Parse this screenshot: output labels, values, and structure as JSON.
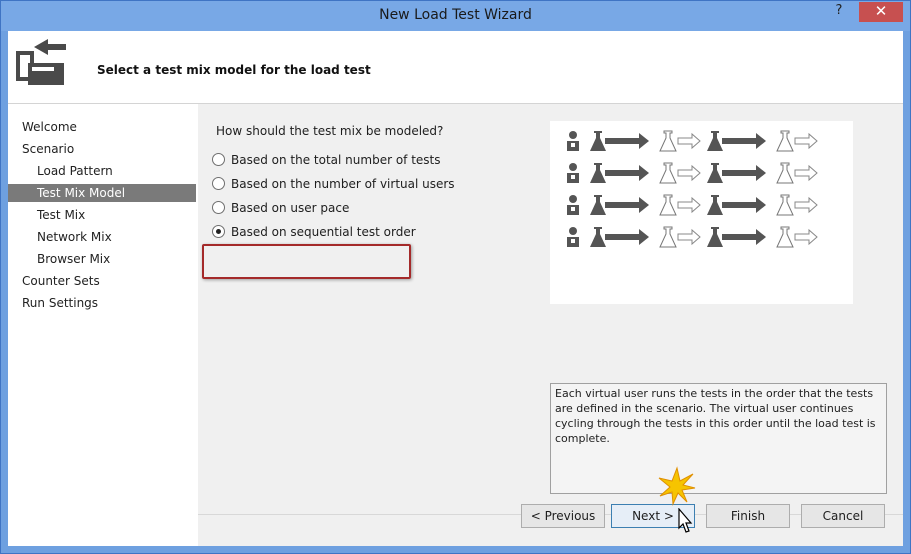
{
  "window": {
    "title": "New Load Test Wizard",
    "help": "?",
    "close": "✕"
  },
  "header": {
    "text": "Select a test mix model for the load test",
    "icon": "wizard-arrow-icon"
  },
  "sidebar": {
    "items": [
      {
        "label": "Welcome"
      },
      {
        "label": "Scenario"
      },
      {
        "label": "Load Pattern"
      },
      {
        "label": "Test Mix Model",
        "selected": true
      },
      {
        "label": "Test Mix"
      },
      {
        "label": "Network Mix"
      },
      {
        "label": "Browser Mix"
      },
      {
        "label": "Counter Sets"
      },
      {
        "label": "Run Settings"
      }
    ]
  },
  "main": {
    "question": "How should the test mix be modeled?",
    "options": [
      {
        "label": "Based on the total number of tests",
        "checked": false
      },
      {
        "label": "Based on the number of virtual users",
        "checked": false
      },
      {
        "label": "Based on user pace",
        "checked": false
      },
      {
        "label": "Based on sequential test order",
        "checked": true
      }
    ],
    "description": "Each virtual user runs the tests in the order that the tests are defined in the scenario. The virtual user continues cycling through the tests in this order until the load test is complete."
  },
  "buttons": {
    "previous": "< Previous",
    "next": "Next >",
    "finish": "Finish",
    "cancel": "Cancel"
  },
  "colors": {
    "title_bar": "#78a8e6",
    "close": "#c75050",
    "selection": "#7a7a7a",
    "highlight_border": "#a42a2a"
  }
}
